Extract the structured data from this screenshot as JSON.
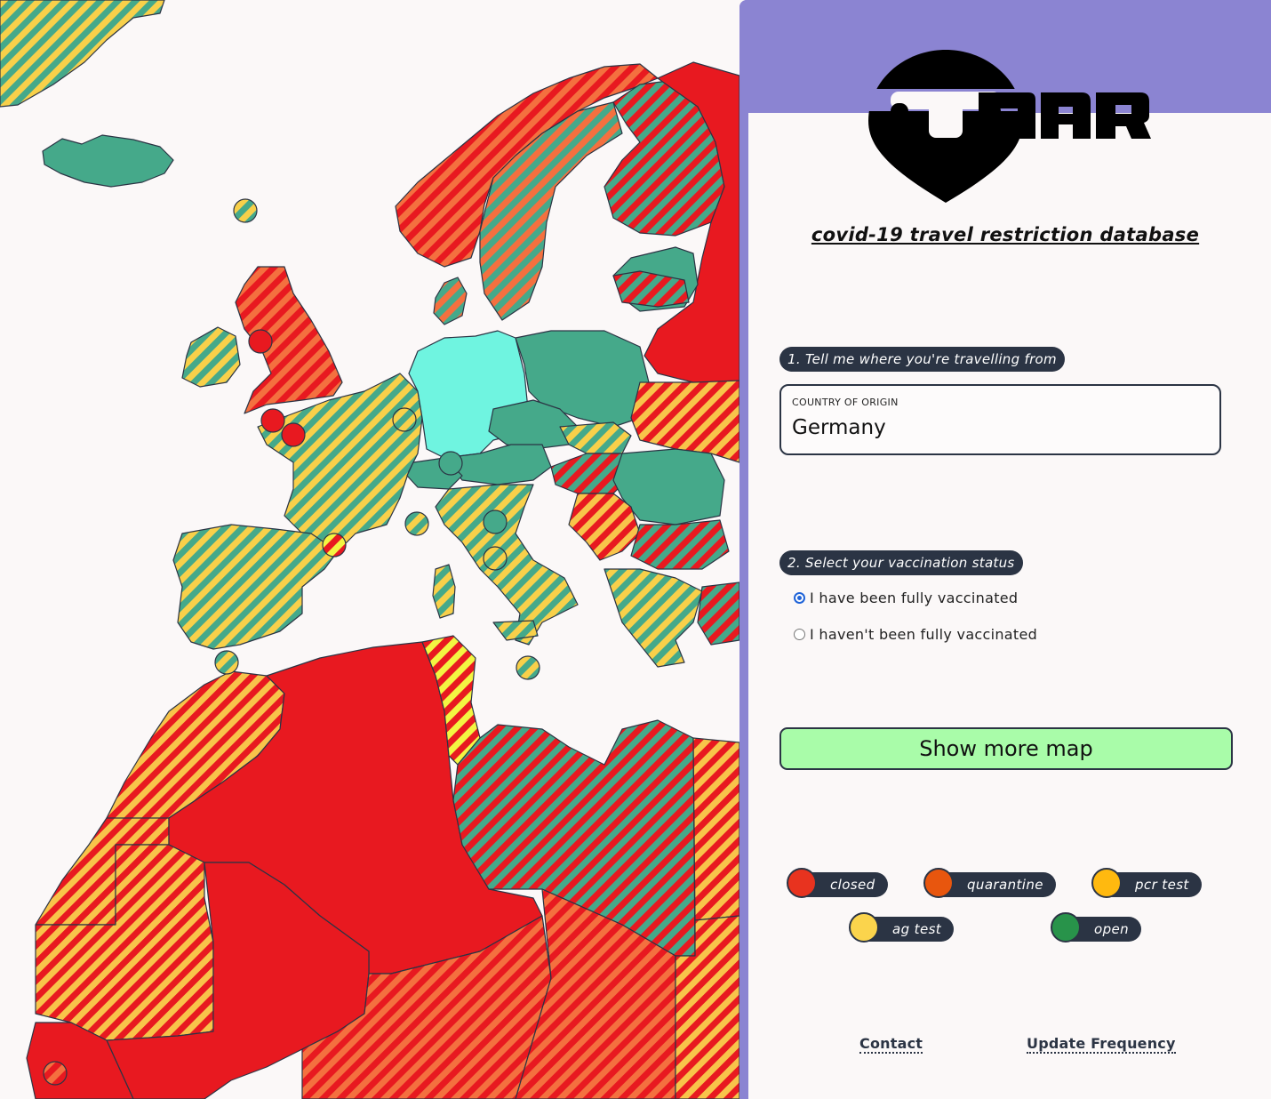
{
  "app": {
    "logo_text": "TNAR",
    "tagline": "covid-19 travel restriction database"
  },
  "step1": {
    "label": "1. Tell me where you're travelling from",
    "field_label": "COUNTRY OF ORIGIN",
    "field_value": "Germany"
  },
  "step2": {
    "label": "2. Select your vaccination status",
    "options": [
      {
        "label": "I have been fully vaccinated",
        "selected": true
      },
      {
        "label": "I haven't been fully vaccinated",
        "selected": false
      }
    ]
  },
  "show_more_label": "Show more map",
  "legend": [
    {
      "label": "closed",
      "color": "#e8331f"
    },
    {
      "label": "quarantine",
      "color": "#e8560e"
    },
    {
      "label": "pcr test",
      "color": "#ffb90f"
    },
    {
      "label": "ag test",
      "color": "#fbd44c"
    },
    {
      "label": "open",
      "color": "#28934a"
    }
  ],
  "footer": {
    "contact": "Contact",
    "update_frequency": "Update Frequency"
  },
  "map_colors": {
    "closed": "#e81920",
    "quarantine": "#f4703f",
    "pcr": "#f8c44a",
    "ag": "#f8d84a",
    "open": "#45a98a",
    "selected": "#6ff4e0",
    "border": "#2b3444",
    "sea": "#fbf8f8"
  }
}
